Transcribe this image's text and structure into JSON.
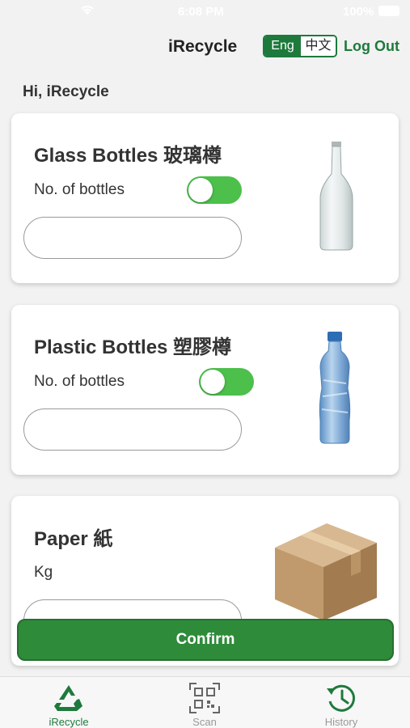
{
  "status_bar": {
    "time": "6:08 PM",
    "battery": "100%"
  },
  "header": {
    "title": "iRecycle",
    "lang_eng": "Eng",
    "lang_zh": "中文",
    "logout": "Log Out"
  },
  "greeting": "Hi, iRecycle",
  "cards": [
    {
      "title": "Glass Bottles 玻璃樽",
      "label": "No. of bottles",
      "input_value": "",
      "toggle_on": true
    },
    {
      "title": "Plastic Bottles 塑膠樽",
      "label": "No. of bottles",
      "input_value": "",
      "toggle_on": true
    },
    {
      "title": "Paper 紙",
      "label": "Kg",
      "input_value": ""
    }
  ],
  "confirm_label": "Confirm",
  "tabs": [
    {
      "label": "iRecycle",
      "icon": "recycle-icon",
      "active": true
    },
    {
      "label": "Scan",
      "icon": "qr-code-icon",
      "active": false
    },
    {
      "label": "History",
      "icon": "history-icon",
      "active": false
    }
  ],
  "colors": {
    "accent": "#1e7a3c",
    "toggle": "#4cc04a",
    "confirm": "#2e8b3a"
  }
}
